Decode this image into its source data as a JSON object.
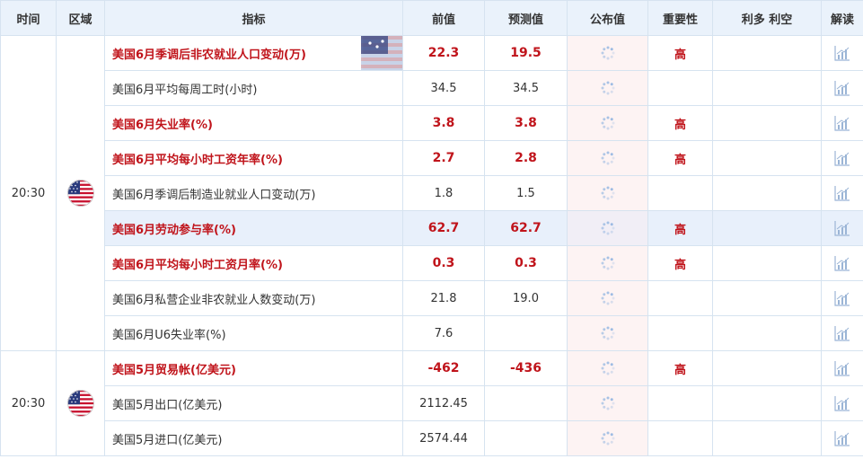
{
  "header": {
    "time": "时间",
    "region": "区域",
    "indicator": "指标",
    "previous": "前值",
    "forecast": "预测值",
    "actual": "公布值",
    "importance": "重要性",
    "effect": "利多 利空",
    "interpret": "解读"
  },
  "groups": [
    {
      "time": "20:30",
      "flag_icon": "us-flag-icon",
      "rows": [
        {
          "name": "美国6月季调后非农就业人口变动(万)",
          "prev": "22.3",
          "forecast": "19.5",
          "importance": "高",
          "important": true
        },
        {
          "name": "美国6月平均每周工时(小时)",
          "prev": "34.5",
          "forecast": "34.5",
          "importance": "",
          "important": false
        },
        {
          "name": "美国6月失业率(%)",
          "prev": "3.8",
          "forecast": "3.8",
          "importance": "高",
          "important": true
        },
        {
          "name": "美国6月平均每小时工资年率(%)",
          "prev": "2.7",
          "forecast": "2.8",
          "importance": "高",
          "important": true
        },
        {
          "name": "美国6月季调后制造业就业人口变动(万)",
          "prev": "1.8",
          "forecast": "1.5",
          "importance": "",
          "important": false
        },
        {
          "name": "美国6月劳动参与率(%)",
          "prev": "62.7",
          "forecast": "62.7",
          "importance": "高",
          "important": true
        },
        {
          "name": "美国6月平均每小时工资月率(%)",
          "prev": "0.3",
          "forecast": "0.3",
          "importance": "高",
          "important": true
        },
        {
          "name": "美国6月私营企业非农就业人数变动(万)",
          "prev": "21.8",
          "forecast": "19.0",
          "importance": "",
          "important": false
        },
        {
          "name": "美国6月U6失业率(%)",
          "prev": "7.6",
          "forecast": "",
          "importance": "",
          "important": false
        }
      ]
    },
    {
      "time": "20:30",
      "flag_icon": "us-flag-icon",
      "rows": [
        {
          "name": "美国5月贸易帐(亿美元)",
          "prev": "-462",
          "forecast": "-436",
          "importance": "高",
          "important": true
        },
        {
          "name": "美国5月出口(亿美元)",
          "prev": "2112.45",
          "forecast": "",
          "importance": "",
          "important": false
        },
        {
          "name": "美国5月进口(亿美元)",
          "prev": "2574.44",
          "forecast": "",
          "importance": "",
          "important": false
        }
      ]
    }
  ],
  "icons": {
    "actual": "loading-spinner-icon",
    "interpret": "bar-chart-icon"
  },
  "colors": {
    "important_text": "#c0141b",
    "header_bg": "#eaf2fb",
    "highlight_row": "#e8f0fb",
    "published_col": "#fdf3f3",
    "border": "#d6e3f0"
  }
}
